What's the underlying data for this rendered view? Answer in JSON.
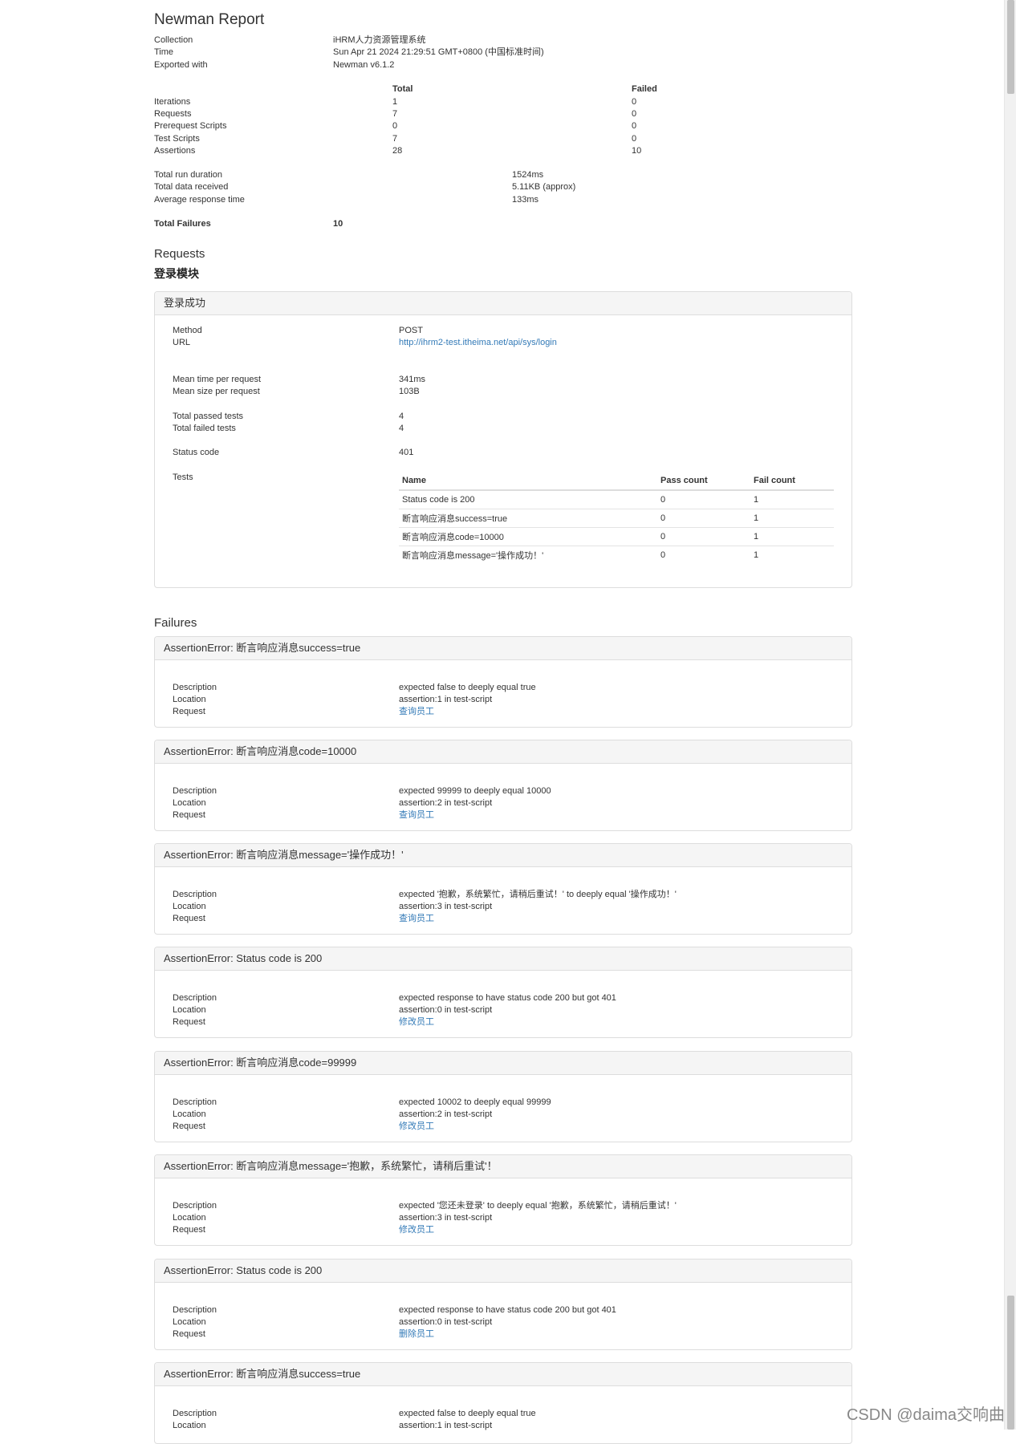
{
  "report": {
    "title": "Newman Report",
    "collection_label": "Collection",
    "collection_value": "iHRM人力资源管理系统",
    "time_label": "Time",
    "time_value": "Sun Apr 21 2024 21:29:51 GMT+0800 (中国标准时间)",
    "exported_label": "Exported with",
    "exported_value": "Newman v6.1.2"
  },
  "summary": {
    "col_total": "Total",
    "col_failed": "Failed",
    "rows": [
      {
        "label": "Iterations",
        "total": "1",
        "failed": "0"
      },
      {
        "label": "Requests",
        "total": "7",
        "failed": "0"
      },
      {
        "label": "Prerequest Scripts",
        "total": "0",
        "failed": "0"
      },
      {
        "label": "Test Scripts",
        "total": "7",
        "failed": "0"
      },
      {
        "label": "Assertions",
        "total": "28",
        "failed": "10"
      }
    ],
    "run_duration_label": "Total run duration",
    "run_duration_value": "1524ms",
    "data_received_label": "Total data received",
    "data_received_value": "5.11KB (approx)",
    "avg_response_label": "Average response time",
    "avg_response_value": "133ms",
    "total_failures_label": "Total Failures",
    "total_failures_value": "10"
  },
  "requests": {
    "heading": "Requests",
    "folder": "登录模块",
    "panel": {
      "title": "登录成功",
      "method_label": "Method",
      "method_value": "POST",
      "url_label": "URL",
      "url_value": "http://ihrm2-test.itheima.net/api/sys/login",
      "mean_time_label": "Mean time per request",
      "mean_time_value": "341ms",
      "mean_size_label": "Mean size per request",
      "mean_size_value": "103B",
      "passed_label": "Total passed tests",
      "passed_value": "4",
      "failed_label": "Total failed tests",
      "failed_value": "4",
      "status_label": "Status code",
      "status_value": "401",
      "tests_label": "Tests",
      "tests_cols": [
        "Name",
        "Pass count",
        "Fail count"
      ],
      "tests_rows": [
        {
          "name": "Status code is 200",
          "pass": "0",
          "fail": "1"
        },
        {
          "name": "断言响应消息success=true",
          "pass": "0",
          "fail": "1"
        },
        {
          "name": "断言响应消息code=10000",
          "pass": "0",
          "fail": "1"
        },
        {
          "name": "断言响应消息message='操作成功！'",
          "pass": "0",
          "fail": "1"
        }
      ]
    }
  },
  "failures": {
    "heading": "Failures",
    "desc_label": "Description",
    "loc_label": "Location",
    "req_label": "Request",
    "items": [
      {
        "title": "AssertionError: 断言响应消息success=true",
        "description": "expected false to deeply equal true",
        "location": "assertion:1 in test-script",
        "request": "查询员工"
      },
      {
        "title": "AssertionError: 断言响应消息code=10000",
        "description": "expected 99999 to deeply equal 10000",
        "location": "assertion:2 in test-script",
        "request": "查询员工"
      },
      {
        "title": "AssertionError: 断言响应消息message='操作成功！'",
        "description": "expected '抱歉，系统繁忙，请稍后重试！' to deeply equal '操作成功！'",
        "location": "assertion:3 in test-script",
        "request": "查询员工"
      },
      {
        "title": "AssertionError: Status code is 200",
        "description": "expected response to have status code 200 but got 401",
        "location": "assertion:0 in test-script",
        "request": "修改员工"
      },
      {
        "title": "AssertionError: 断言响应消息code=99999",
        "description": "expected 10002 to deeply equal 99999",
        "location": "assertion:2 in test-script",
        "request": "修改员工"
      },
      {
        "title": "AssertionError: 断言响应消息message='抱歉，系统繁忙，请稍后重试'！",
        "description": "expected '您还未登录' to deeply equal '抱歉，系统繁忙，请稍后重试！'",
        "location": "assertion:3 in test-script",
        "request": "修改员工"
      },
      {
        "title": "AssertionError: Status code is 200",
        "description": "expected response to have status code 200 but got 401",
        "location": "assertion:0 in test-script",
        "request": "删除员工"
      },
      {
        "title": "AssertionError: 断言响应消息success=true",
        "description": "expected false to deeply equal true",
        "location": "assertion:1 in test-script",
        "request": ""
      }
    ]
  },
  "watermark": "CSDN @daima交响曲"
}
